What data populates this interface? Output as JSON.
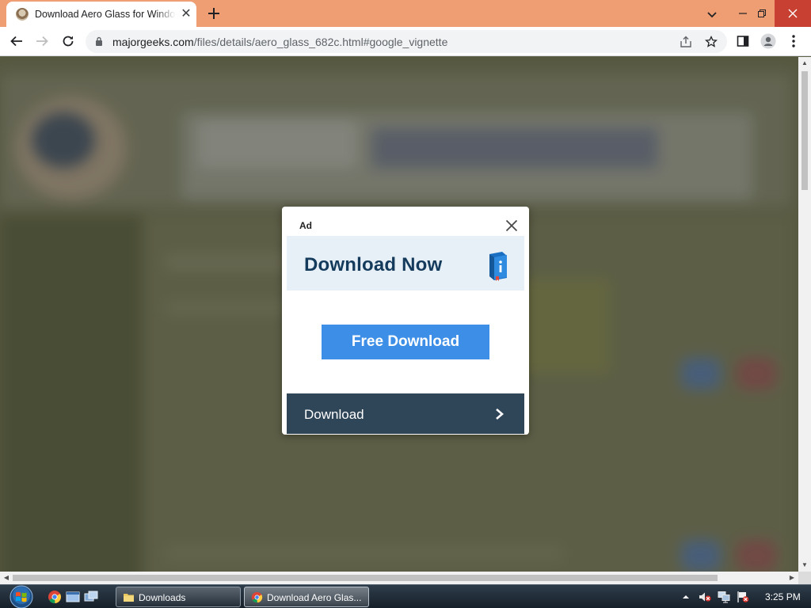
{
  "browser": {
    "tab": {
      "title": "Download Aero Glass for Windows",
      "favicon": "majorgeeks-favicon"
    },
    "new_tab_icon": "plus-icon",
    "window_controls": [
      "tab-search-icon",
      "minimize-icon",
      "restore-icon",
      "close-icon"
    ],
    "toolbar": {
      "back_icon": "arrow-left-icon",
      "forward_icon": "arrow-right-icon",
      "reload_icon": "reload-icon",
      "url_host": "majorgeeks.com",
      "url_path": "/files/details/aero_glass_682c.html#google_vignette",
      "omnibox_icons": [
        "share-icon",
        "star-icon"
      ],
      "right_icons": [
        "side-panel-icon",
        "profile-icon",
        "menu-dots-icon"
      ]
    },
    "colors": {
      "tab_strip": "#ee9e72",
      "close_button": "#c84031"
    }
  },
  "ad": {
    "label": "Ad",
    "banner_title": "Download Now",
    "free_download_label": "Free Download",
    "bottom_label": "Download",
    "colors": {
      "banner_bg": "#e7f0f7",
      "title": "#143a5c",
      "button": "#3d8ee6",
      "bottom_bar": "#2f4558"
    }
  },
  "taskbar": {
    "quick_launch": [
      "chrome-icon",
      "show-desktop-icon",
      "switch-windows-icon"
    ],
    "buttons": [
      {
        "label": "Downloads",
        "icon": "folder-icon"
      },
      {
        "label": "Download Aero Glas...",
        "icon": "chrome-icon"
      }
    ],
    "tray": [
      "show-hidden-icons-arrow",
      "volume-muted-icon",
      "network-icon",
      "action-center-flag-icon"
    ],
    "clock": "3:25 PM"
  }
}
